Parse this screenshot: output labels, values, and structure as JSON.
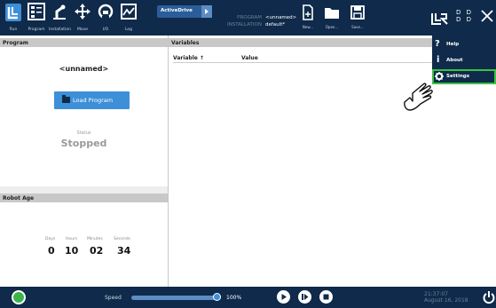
{
  "header": {
    "nav": [
      {
        "label": "Run",
        "icon": "run-icon"
      },
      {
        "label": "Program",
        "icon": "program-icon"
      },
      {
        "label": "Installation",
        "icon": "installation-icon"
      },
      {
        "label": "Move",
        "icon": "move-icon"
      },
      {
        "label": "I/O",
        "icon": "io-icon"
      },
      {
        "label": "Log",
        "icon": "log-icon"
      }
    ],
    "activedrive": "ActiveDrive",
    "program_key": "PROGRAM",
    "program_value": "<unnamed>",
    "installation_key": "INSTALLATION",
    "installation_value": "default*",
    "new_label": "New...",
    "open_label": "Open...",
    "save_label": "Save..."
  },
  "left": {
    "program_header": "Program",
    "program_name": "<unnamed>",
    "load_button": "Load Program",
    "status_label": "Status",
    "status_value": "Stopped",
    "age_header": "Robot Age",
    "age_labels": [
      "Days",
      "Hours",
      "Minutes",
      "Seconds"
    ],
    "age_values": [
      "0",
      "10",
      "02",
      "34"
    ]
  },
  "variables": {
    "header": "Variables",
    "col_variable": "Variable ↑",
    "col_value": "Value"
  },
  "menu": {
    "items": [
      {
        "label": "Help",
        "icon": "question-icon"
      },
      {
        "label": "About",
        "icon": "info-icon"
      },
      {
        "label": "Settings",
        "icon": "gear-icon",
        "selected": true
      }
    ]
  },
  "footer": {
    "speed_label": "Speed",
    "speed_value": "100%",
    "speed_fraction": 1.0,
    "time": "21:37:07",
    "date": "August 16, 2018"
  },
  "colors": {
    "navy": "#0f2a4a",
    "accent_blue": "#3d8fd8",
    "selection_green": "#39c244",
    "status_green": "#3bb34a"
  }
}
